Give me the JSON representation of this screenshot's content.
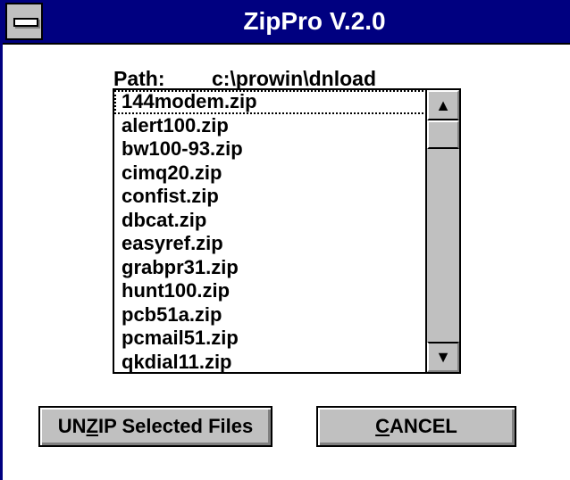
{
  "window": {
    "title": "ZipPro V.2.0",
    "system_menu_icon": "system-menu-icon"
  },
  "path": {
    "label": "Path:",
    "value": "c:\\prowin\\dnload"
  },
  "file_list": {
    "items": [
      "144modem.zip",
      "alert100.zip",
      "bw100-93.zip",
      "cimq20.zip",
      "confist.zip",
      "dbcat.zip",
      "easyref.zip",
      "grabpr31.zip",
      "hunt100.zip",
      "pcb51a.zip",
      "pcmail51.zip",
      "qkdial11.zip"
    ],
    "focused_index": 0,
    "scroll_up_icon": "arrow-up-icon",
    "scroll_down_icon": "arrow-down-icon"
  },
  "buttons": {
    "unzip": {
      "prefix": "UN",
      "mnemonic": "Z",
      "suffix": "IP Selected Files"
    },
    "cancel": {
      "prefix": "",
      "mnemonic": "C",
      "suffix": "ANCEL"
    }
  },
  "colors": {
    "titlebar": "#000080",
    "face": "#c0c0c0",
    "background": "#ffffff"
  }
}
